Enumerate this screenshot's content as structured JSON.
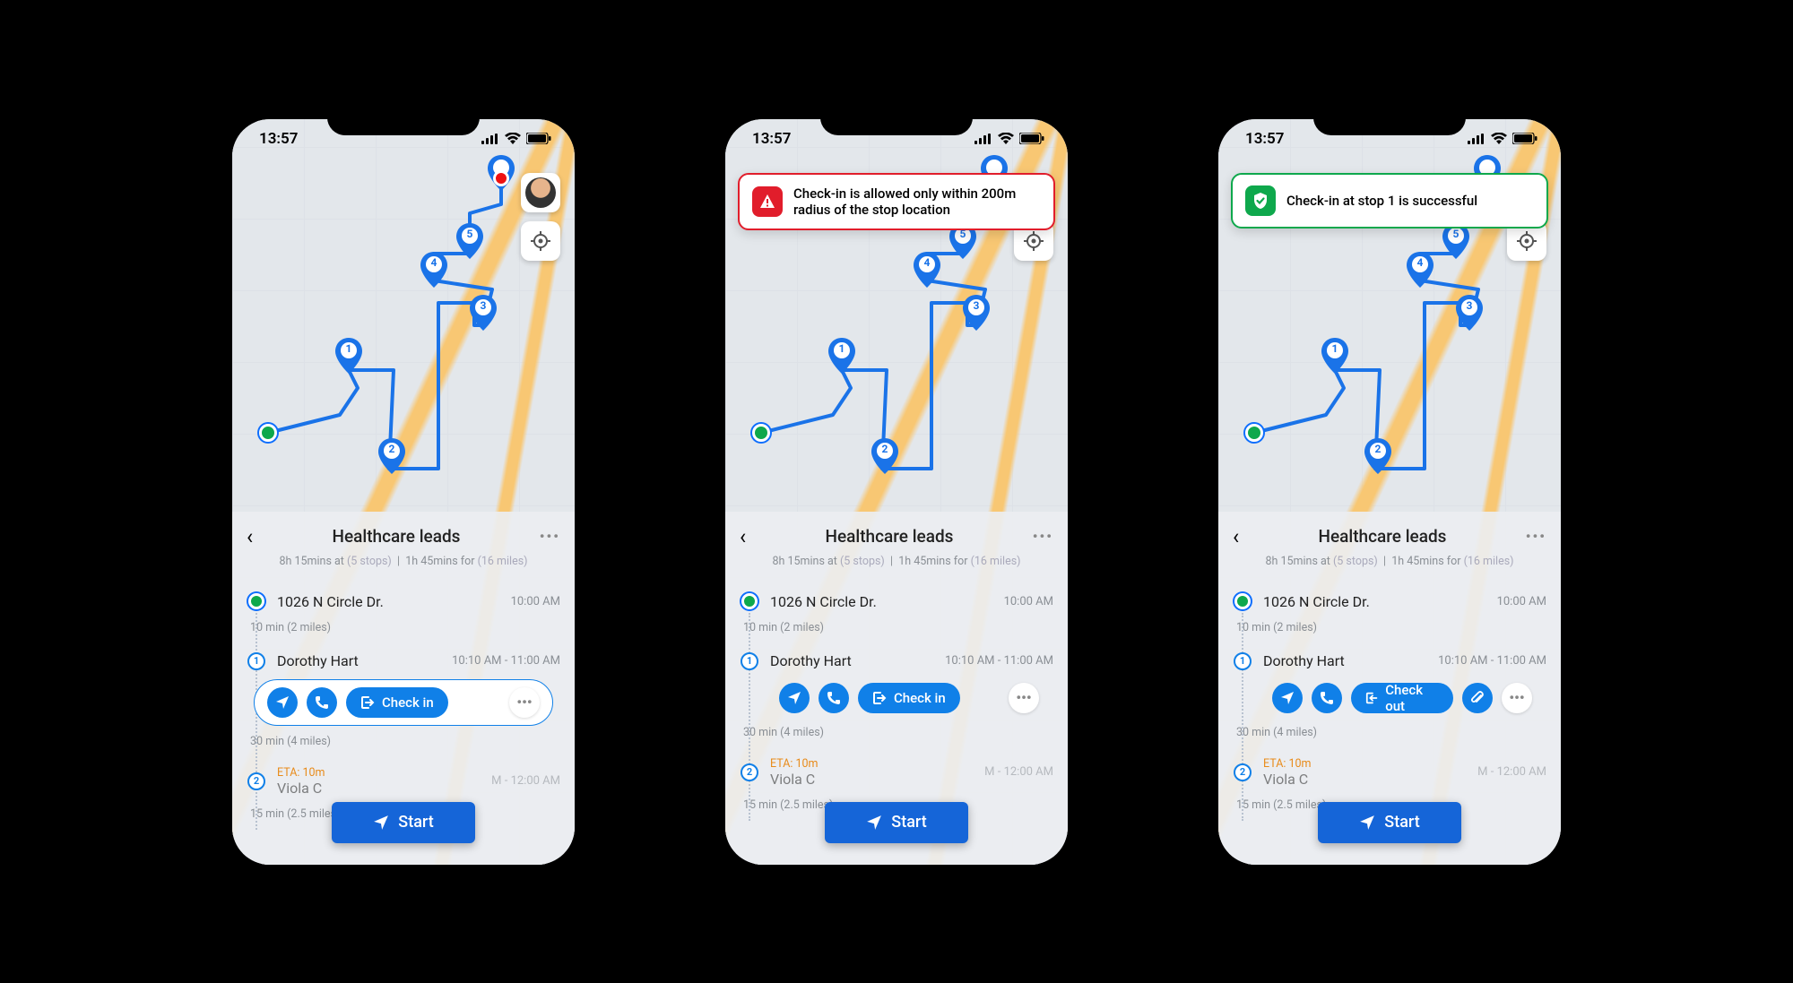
{
  "status": {
    "time": "13:57"
  },
  "route": {
    "title": "Healthcare leads",
    "summary_at": "8h 15mins at",
    "summary_at_paren": "(5 stops)",
    "summary_for": "1h 45mins for",
    "summary_for_paren": "(16 miles)"
  },
  "toasts": {
    "error": "Check-in is allowed only within 200m radius of the stop location",
    "success": "Check-in at stop 1 is successful"
  },
  "stops": {
    "origin": {
      "name": "1026 N Circle Dr.",
      "time": "10:00 AM"
    },
    "seg1": "10 min (2 miles)",
    "s1": {
      "num": "1",
      "name": "Dorothy Hart",
      "time": "10:10 AM - 11:00 AM"
    },
    "seg2": "30 min (4 miles)",
    "s2": {
      "num": "2",
      "eta": "ETA: 10m",
      "name_cut": "Viola C",
      "time_cut": "M - 12:00 AM"
    },
    "seg3": "15 min (2.5 miles)"
  },
  "buttons": {
    "checkin": "Check in",
    "checkout": "Check out",
    "start": "Start"
  },
  "colors": {
    "primary": "#1080e8",
    "start": "#1565d8",
    "error": "#e11d2b",
    "success": "#0ea84c",
    "eta": "#e88b1a"
  },
  "map_pins": [
    "1",
    "2",
    "3",
    "4",
    "5"
  ]
}
